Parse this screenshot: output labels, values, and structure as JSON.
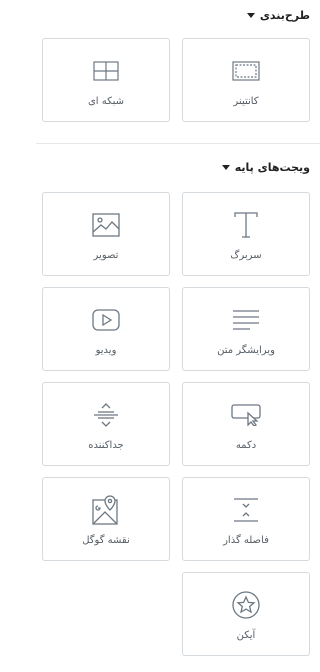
{
  "sections": [
    {
      "title": "طرح‌بندی",
      "items": [
        {
          "label": "کانتینر",
          "icon": "container-icon"
        },
        {
          "label": "شبکه ای",
          "icon": "grid-icon"
        }
      ]
    },
    {
      "title": "ویجت‌های پایه",
      "items": [
        {
          "label": "سربرگ",
          "icon": "heading-icon"
        },
        {
          "label": "تصویر",
          "icon": "image-icon"
        },
        {
          "label": "ویرایشگر متن",
          "icon": "text-editor-icon"
        },
        {
          "label": "ویدیو",
          "icon": "video-icon"
        },
        {
          "label": "دکمه",
          "icon": "button-icon"
        },
        {
          "label": "جداکننده",
          "icon": "divider-icon"
        },
        {
          "label": "فاصله گذار",
          "icon": "spacer-icon"
        },
        {
          "label": "نقشه گوگل",
          "icon": "google-maps-icon"
        },
        {
          "label": "آیکن",
          "icon": "star-icon"
        }
      ]
    }
  ],
  "colors": {
    "border": "#d5dadf",
    "text": "#555d66",
    "heading": "#222222",
    "icon_stroke": "#6d7882"
  }
}
